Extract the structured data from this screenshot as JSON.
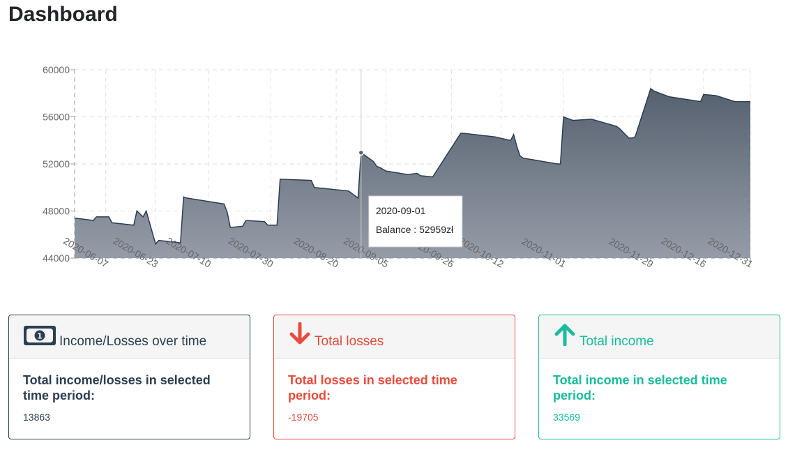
{
  "page": {
    "title": "Dashboard"
  },
  "chart_data": {
    "type": "area",
    "y_ticks": [
      44000,
      48000,
      52000,
      56000,
      60000
    ],
    "ylim": [
      44000,
      60000
    ],
    "x_tick_labels": [
      "2020-06-07",
      "2020-06-23",
      "2020-07-10",
      "2020-07-30",
      "2020-08-20",
      "2020-09-05",
      "2020-09-26",
      "2020-10-12",
      "2020-11-01",
      "2020-11-29",
      "2020-12-16",
      "2020-12-31"
    ],
    "grid": true,
    "series": [
      {
        "x": [
          "2020-05-28",
          "2020-06-03",
          "2020-06-04",
          "2020-06-08",
          "2020-06-09",
          "2020-06-16",
          "2020-06-17",
          "2020-06-19",
          "2020-06-20",
          "2020-06-23",
          "2020-06-24",
          "2020-07-01",
          "2020-07-02",
          "2020-07-03",
          "2020-07-15",
          "2020-07-16",
          "2020-07-17",
          "2020-07-21",
          "2020-07-22",
          "2020-07-28",
          "2020-07-29",
          "2020-08-01",
          "2020-08-02",
          "2020-08-12",
          "2020-08-13",
          "2020-08-24",
          "2020-08-25",
          "2020-08-27",
          "2020-08-28",
          "2020-09-01",
          "2020-09-02",
          "2020-09-03",
          "2020-09-05",
          "2020-09-12",
          "2020-09-15",
          "2020-09-16",
          "2020-09-20",
          "2020-09-29",
          "2020-09-30",
          "2020-10-10",
          "2020-10-15",
          "2020-10-16",
          "2020-10-17",
          "2020-10-18",
          "2020-10-19",
          "2020-10-30",
          "2020-10-31",
          "2020-11-01",
          "2020-11-04",
          "2020-11-10",
          "2020-11-18",
          "2020-11-19",
          "2020-11-22",
          "2020-11-23",
          "2020-11-24",
          "2020-11-29",
          "2020-11-30",
          "2020-12-05",
          "2020-12-15",
          "2020-12-16",
          "2020-12-20",
          "2020-12-26",
          "2020-12-31"
        ],
        "y": [
          47400,
          47200,
          47500,
          47500,
          47000,
          46800,
          48000,
          47500,
          48000,
          45200,
          45500,
          45300,
          49200,
          49100,
          48600,
          47900,
          46600,
          46700,
          47200,
          47100,
          46800,
          46800,
          50700,
          50600,
          50000,
          49700,
          49500,
          49100,
          52959,
          52200,
          51800,
          51700,
          51400,
          51100,
          51200,
          51000,
          50900,
          54600,
          54600,
          54300,
          54000,
          54500,
          53500,
          52700,
          52500,
          52000,
          52000,
          56000,
          55700,
          55800,
          55200,
          55000,
          54200,
          54200,
          54300,
          58400,
          58200,
          57700,
          57300,
          57900,
          57800,
          57300,
          57300
        ]
      }
    ],
    "area_colors": {
      "top": "#56616f",
      "bottom": "#959ca8"
    },
    "line_color": "#2c3e50",
    "tooltip": {
      "date": "2020-09-01",
      "text": "Balance : 52959zł",
      "index": 28
    }
  },
  "cards": {
    "net": {
      "icon": "money-bill-icon",
      "header": "Income/Losses over time",
      "title": "Total income/losses in selected time period:",
      "value": "13863",
      "color": "#2c3e50"
    },
    "losses": {
      "icon": "arrow-down-icon",
      "header": "Total losses",
      "title": "Total losses in selected time period:",
      "value": "-19705",
      "color": "#e74c3c"
    },
    "income": {
      "icon": "arrow-up-icon",
      "header": "Total income",
      "title": "Total income in selected time period:",
      "value": "33569",
      "color": "#18bc9c"
    }
  }
}
